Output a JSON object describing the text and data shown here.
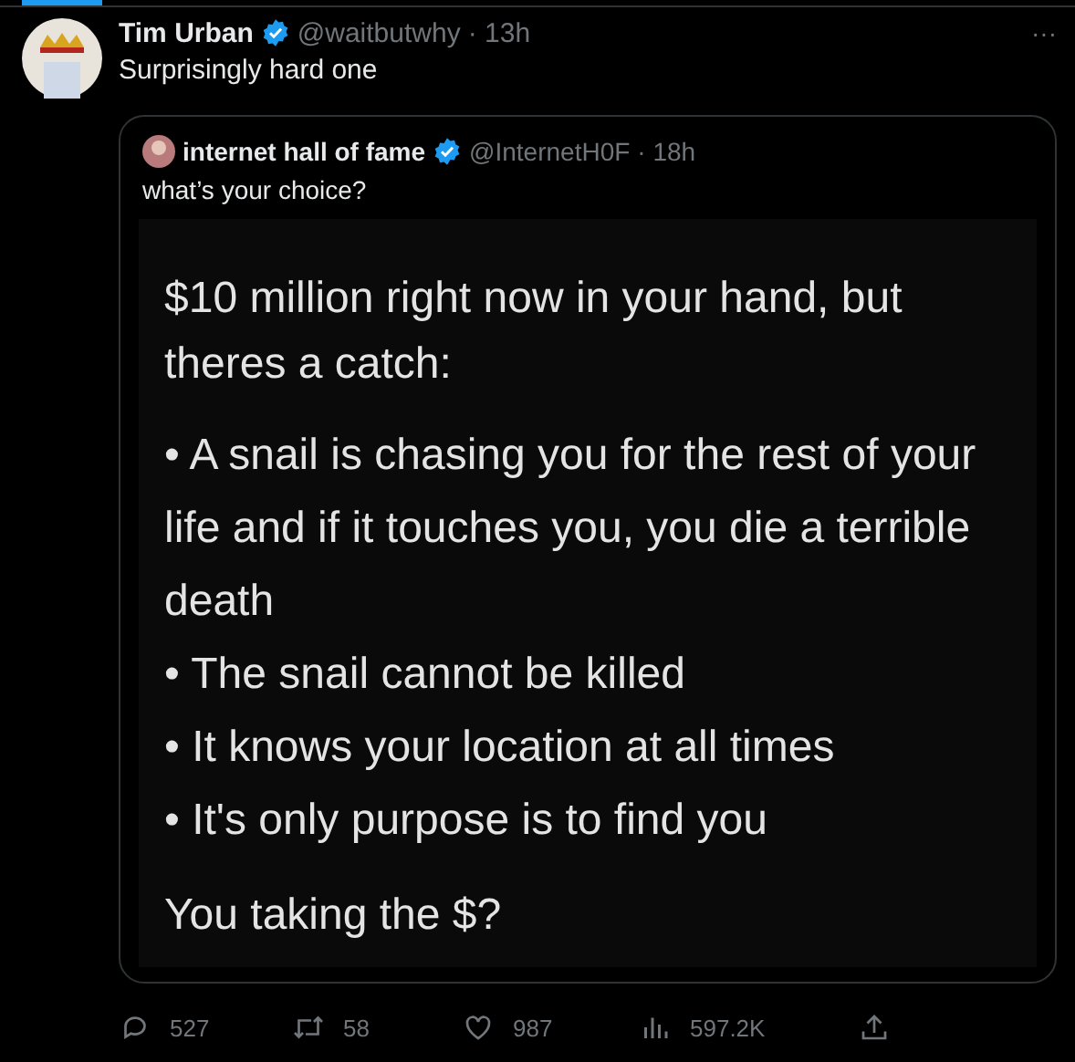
{
  "tweet": {
    "name": "Tim Urban",
    "handle": "@waitbutwhy",
    "time": "· 13h",
    "text": "Surprisingly hard one",
    "more": "···",
    "quote": {
      "name": "internet hall of fame",
      "handle": "@InternetH0F",
      "time": "· 18h",
      "text": "what’s your choice?",
      "image_text": [
        {
          "kind": "para",
          "text": "$10 million right now in your hand, but theres a catch:"
        },
        {
          "kind": "bullet",
          "text": "• A snail is chasing you for the rest of your life and if it touches you, you die a terrible death"
        },
        {
          "kind": "bullet",
          "text": "• The snail cannot be killed"
        },
        {
          "kind": "bullet",
          "text": "• It knows your location at all times"
        },
        {
          "kind": "bullet",
          "text": "• It's only purpose is to find you"
        },
        {
          "kind": "gap",
          "text": "You taking the $?"
        }
      ]
    },
    "actions": [
      {
        "kind": "reply",
        "count": "527"
      },
      {
        "kind": "retweet",
        "count": "58"
      },
      {
        "kind": "like",
        "count": "987"
      },
      {
        "kind": "views",
        "count": "597.2K"
      },
      {
        "kind": "share"
      }
    ]
  }
}
